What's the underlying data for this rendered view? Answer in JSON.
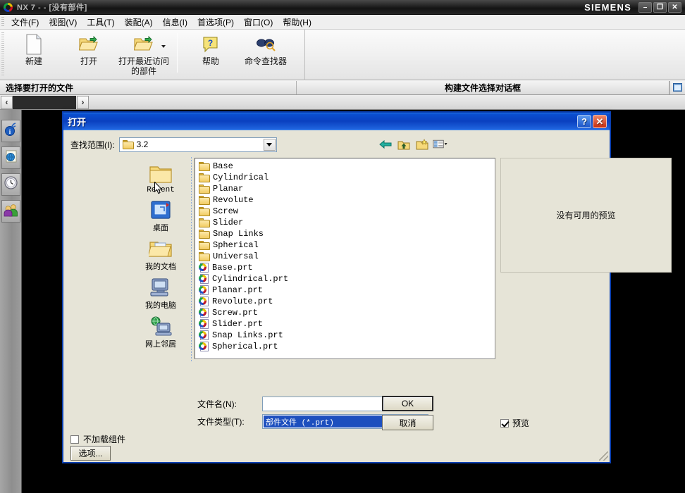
{
  "window": {
    "title": "NX 7 -  -  [没有部件]",
    "brand": "SIEMENS",
    "minimize_label": "–",
    "restore_label": "❐",
    "close_label": "✕"
  },
  "menubar": {
    "items": [
      {
        "label": "文件(F)"
      },
      {
        "label": "视图(V)"
      },
      {
        "label": "工具(T)"
      },
      {
        "label": "装配(A)"
      },
      {
        "label": "信息(I)"
      },
      {
        "label": "首选项(P)"
      },
      {
        "label": "窗口(O)"
      },
      {
        "label": "帮助(H)"
      }
    ]
  },
  "ribbon": {
    "buttons": [
      {
        "label": "新建",
        "icon": "new-document-icon"
      },
      {
        "label": "打开",
        "icon": "open-folder-icon"
      },
      {
        "label": "打开最近访问\n的部件",
        "icon": "open-recent-folder-icon"
      },
      {
        "label": "帮助",
        "icon": "help-question-icon"
      },
      {
        "label": "命令查找器",
        "icon": "command-finder-icon"
      }
    ]
  },
  "cuebar": {
    "left": "选择要打开的文件",
    "middle": "构建文件选择对话框"
  },
  "navrow": {
    "back_label": "‹",
    "forward_label": "›"
  },
  "rail": {
    "items": [
      {
        "icon": "assembly-navigator-icon"
      },
      {
        "icon": "internet-explorer-icon"
      },
      {
        "icon": "history-clock-icon"
      },
      {
        "icon": "roles-people-icon"
      }
    ]
  },
  "dialog": {
    "title": "打开",
    "help_label": "?",
    "close_label": "✕",
    "lookin": {
      "label": "查找范围(I):",
      "value": "3.2"
    },
    "nav_tools": [
      {
        "icon": "back-arrow-icon"
      },
      {
        "icon": "up-one-level-icon"
      },
      {
        "icon": "new-folder-icon"
      },
      {
        "icon": "views-menu-icon"
      }
    ],
    "places": [
      {
        "label": "Recent",
        "icon": "recent-folder-icon"
      },
      {
        "label": "桌面",
        "icon": "desktop-icon"
      },
      {
        "label": "我的文档",
        "icon": "my-documents-icon"
      },
      {
        "label": "我的电脑",
        "icon": "my-computer-icon"
      },
      {
        "label": "网上邻居",
        "icon": "network-neighborhood-icon"
      }
    ],
    "files": [
      {
        "name": "Base",
        "type": "folder"
      },
      {
        "name": "Cylindrical",
        "type": "folder"
      },
      {
        "name": "Planar",
        "type": "folder"
      },
      {
        "name": "Revolute",
        "type": "folder"
      },
      {
        "name": "Screw",
        "type": "folder"
      },
      {
        "name": "Slider",
        "type": "folder"
      },
      {
        "name": "Snap Links",
        "type": "folder"
      },
      {
        "name": "Spherical",
        "type": "folder"
      },
      {
        "name": "Universal",
        "type": "folder"
      },
      {
        "name": "Base.prt",
        "type": "part"
      },
      {
        "name": "Cylindrical.prt",
        "type": "part"
      },
      {
        "name": "Planar.prt",
        "type": "part"
      },
      {
        "name": "Revolute.prt",
        "type": "part"
      },
      {
        "name": "Screw.prt",
        "type": "part"
      },
      {
        "name": "Slider.prt",
        "type": "part"
      },
      {
        "name": "Snap Links.prt",
        "type": "part"
      },
      {
        "name": "Spherical.prt",
        "type": "part"
      }
    ],
    "preview": {
      "empty_text": "没有可用的预览",
      "checkbox_label": "预览",
      "checked": true
    },
    "filename": {
      "label": "文件名(N):",
      "value": "",
      "placeholder": ""
    },
    "filetype": {
      "label": "文件类型(T):",
      "value": "部件文件  (*.prt)"
    },
    "ok_label": "OK",
    "cancel_label": "取消",
    "no_load_components": {
      "label": "不加载组件",
      "checked": false
    },
    "options_label": "选项..."
  },
  "colors": {
    "dialog_title_blue": "#0a40c0",
    "dialog_bg": "#e6e4d7",
    "selection_blue": "#1d4fbe",
    "canvas_black": "#000000"
  }
}
